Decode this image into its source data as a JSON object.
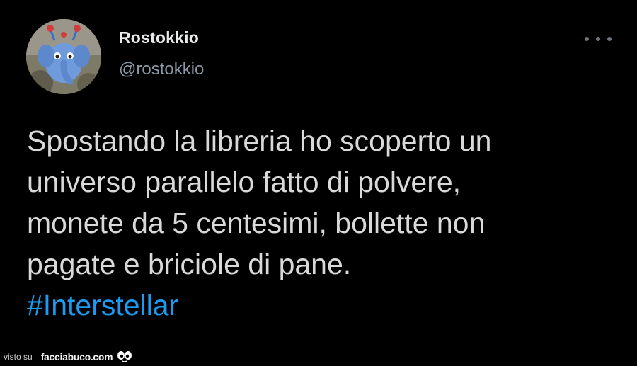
{
  "tweet": {
    "author": {
      "display_name": "Rostokkio",
      "handle": "@rostokkio",
      "avatar_icon": "cartoon-elephant-avatar"
    },
    "more_icon": "more-options-icon",
    "text_lines": [
      "Spostando la libreria ho scoperto un",
      "universo parallelo fatto di polvere,",
      "monete da 5 centesimi, bollette non",
      "pagate e briciole di pane."
    ],
    "hashtag": "#Interstellar"
  },
  "footer": {
    "visto_label": "visto su",
    "site_name": "facciabuco.com",
    "logo_icon": "facciabuco-eyes-logo"
  },
  "colors": {
    "background": "#000000",
    "text": "#d9d9d9",
    "handle": "#8b98a5",
    "hashtag": "#1d9bf0"
  }
}
